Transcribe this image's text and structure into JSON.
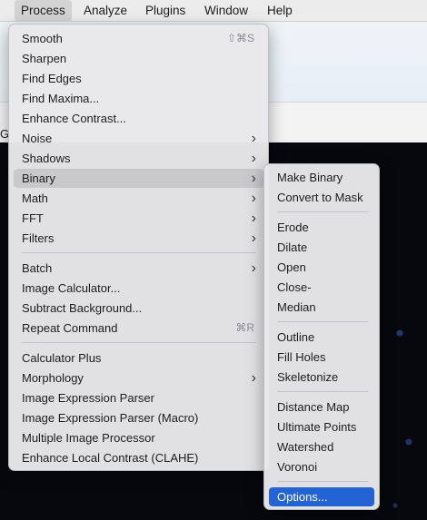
{
  "menubar": {
    "items": [
      {
        "label": ""
      },
      {
        "label": "Process"
      },
      {
        "label": "Analyze"
      },
      {
        "label": "Plugins"
      },
      {
        "label": "Window"
      },
      {
        "label": "Help"
      }
    ]
  },
  "window": {
    "strip_letter": "G"
  },
  "process_menu": {
    "items": [
      {
        "label": "Smooth",
        "shortcut": "⇧⌘S"
      },
      {
        "label": "Sharpen"
      },
      {
        "label": "Find Edges"
      },
      {
        "label": "Find Maxima..."
      },
      {
        "label": "Enhance Contrast..."
      },
      {
        "label": "Noise"
      },
      {
        "label": "Shadows"
      },
      {
        "label": "Binary"
      },
      {
        "label": "Math"
      },
      {
        "label": "FFT"
      },
      {
        "label": "Filters"
      },
      {
        "label": "Batch"
      },
      {
        "label": "Image Calculator..."
      },
      {
        "label": "Subtract Background..."
      },
      {
        "label": "Repeat Command",
        "shortcut": "⌘R"
      },
      {
        "label": "Calculator Plus"
      },
      {
        "label": "Morphology"
      },
      {
        "label": "Image Expression Parser"
      },
      {
        "label": "Image Expression Parser (Macro)"
      },
      {
        "label": "Multiple Image Processor"
      },
      {
        "label": "Enhance Local Contrast (CLAHE)"
      }
    ],
    "submenu_arrow": "›"
  },
  "binary_menu": {
    "items": [
      {
        "label": "Make Binary"
      },
      {
        "label": "Convert to Mask"
      },
      {
        "label": "Erode"
      },
      {
        "label": "Dilate"
      },
      {
        "label": "Open"
      },
      {
        "label": "Close-"
      },
      {
        "label": "Median"
      },
      {
        "label": "Outline"
      },
      {
        "label": "Fill Holes"
      },
      {
        "label": "Skeletonize"
      },
      {
        "label": "Distance Map"
      },
      {
        "label": "Ultimate Points"
      },
      {
        "label": "Watershed"
      },
      {
        "label": "Voronoi"
      },
      {
        "label": "Options..."
      }
    ]
  },
  "colors": {
    "selection": "#2463d4",
    "hover": "#c9c9cc"
  }
}
